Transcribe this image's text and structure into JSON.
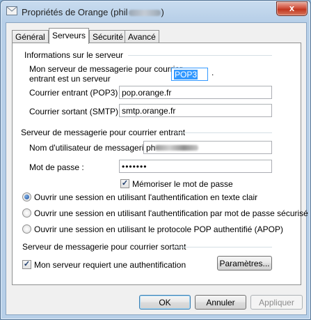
{
  "window": {
    "title_prefix": "Propriétés de Orange (phil",
    "title_suffix": ")",
    "close_label": "x"
  },
  "tabs": [
    {
      "label": "Général"
    },
    {
      "label": "Serveurs"
    },
    {
      "label": "Sécurité"
    },
    {
      "label": "Avancé"
    }
  ],
  "server_info": {
    "heading": "Informations sur le serveur",
    "incoming_type_label_line1": "Mon serveur de messagerie pour courrier",
    "incoming_type_label_line2": "entrant est un serveur",
    "incoming_type_value": "POP3",
    "incoming_type_suffix": ".",
    "incoming_label": "Courrier entrant (POP3) :",
    "incoming_value": "pop.orange.fr",
    "outgoing_label": "Courrier sortant (SMTP) :",
    "outgoing_value": "smtp.orange.fr"
  },
  "incoming_server": {
    "heading": "Serveur de messagerie pour courrier entrant",
    "username_label": "Nom d'utilisateur de messagerie :",
    "username_value_prefix": "ph",
    "password_label": "Mot de passe :",
    "password_value": "•••••••",
    "remember_password_label": "Mémoriser le mot de passe",
    "remember_password_checked": true,
    "auth_options": [
      {
        "label": "Ouvrir une session en utilisant l'authentification en texte clair",
        "selected": true
      },
      {
        "label": "Ouvrir une session en utilisant l'authentification par mot de passe sécurisé",
        "selected": false
      },
      {
        "label": "Ouvrir une session en utilisant le protocole POP authentifié (APOP)",
        "selected": false
      }
    ]
  },
  "outgoing_server": {
    "heading": "Serveur de messagerie pour courrier sortant",
    "requires_auth_label": "Mon serveur requiert une authentification",
    "requires_auth_checked": true,
    "settings_button": "Paramètres..."
  },
  "footer": {
    "ok_button": "OK",
    "cancel_button": "Annuler",
    "apply_button": "Appliquer"
  }
}
